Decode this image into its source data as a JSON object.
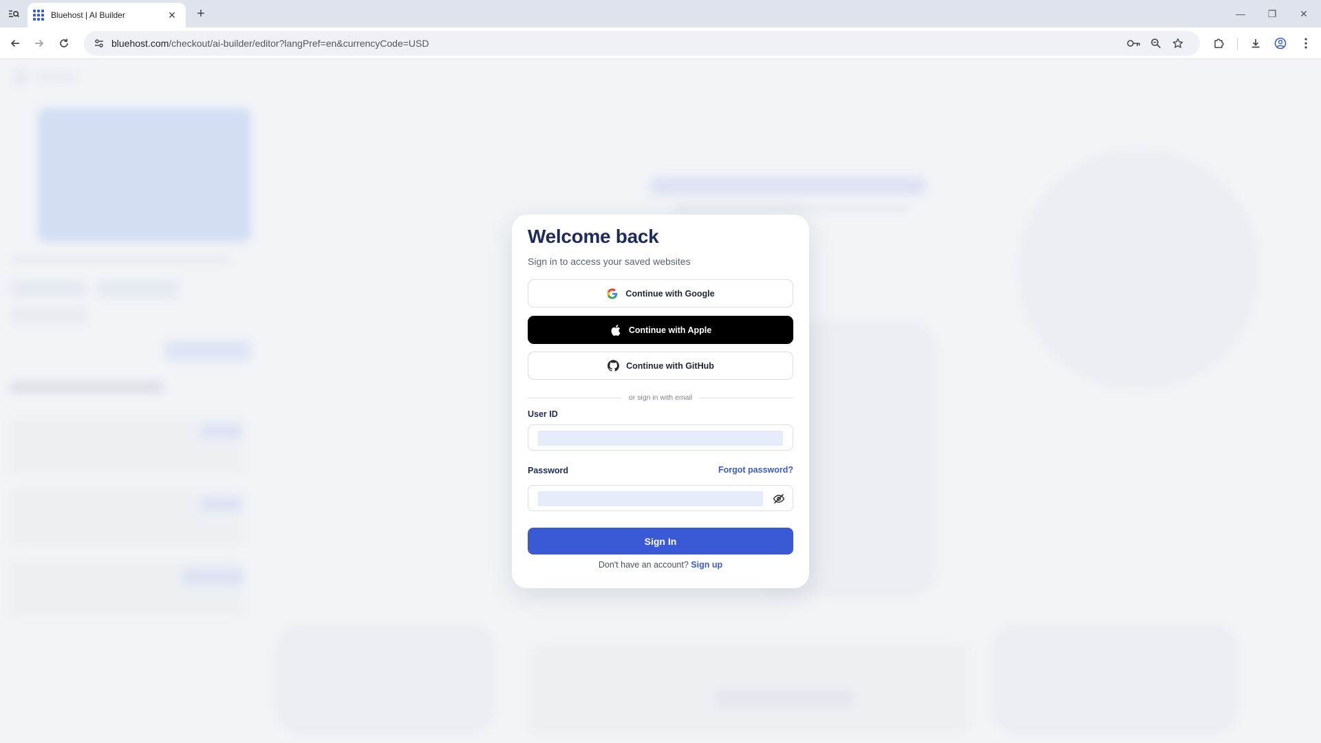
{
  "browser": {
    "tab": {
      "title": "Bluehost | AI Builder",
      "close_glyph": "✕"
    },
    "new_tab_glyph": "+",
    "url": {
      "host": "bluehost.com",
      "path": "/checkout/ai-builder/editor?langPref=en&currencyCode=USD"
    },
    "window_controls": {
      "minimize": "—",
      "restore": "❐",
      "close": "✕"
    }
  },
  "icons": {
    "tab_search": "tab-search-icon",
    "back": "back-arrow-icon",
    "forward": "forward-arrow-icon",
    "reload": "reload-icon",
    "site_info": "tune-icon",
    "password_key": "key-icon",
    "zoom": "zoom-icon",
    "bookmark": "star-icon",
    "extensions": "puzzle-icon",
    "download": "download-icon",
    "profile": "profile-icon",
    "menu": "kebab-menu-icon",
    "google": "google-logo-icon",
    "apple": "apple-logo-icon",
    "github": "github-logo-icon",
    "password_visibility": "eye-slash-icon"
  },
  "modal": {
    "title": "Welcome back",
    "subtitle": "Sign in to access your saved websites",
    "google_label": "Continue with Google",
    "apple_label": "Continue with Apple",
    "github_label": "Continue with GitHub",
    "divider_text": "or sign in with email",
    "user_id_label": "User ID",
    "user_id_value": "",
    "password_label": "Password",
    "password_value": "",
    "forgot_label": "Forgot password?",
    "signin_label": "Sign In",
    "no_account_text": "Don't have an account?",
    "signup_label": "Sign up"
  },
  "colors": {
    "brand_blue": "#3a5ad5",
    "heading_navy": "#1c2a5c",
    "apple_button": "#000000",
    "input_fill": "#e6ebfa"
  }
}
